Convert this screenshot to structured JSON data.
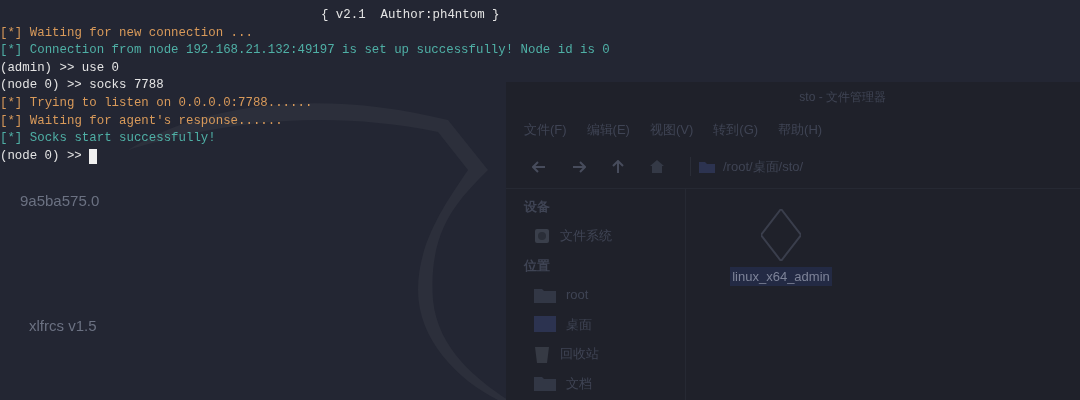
{
  "desktop": {
    "icons": [
      {
        "label": "9a5ba575.0"
      },
      {
        "label": "xlfrcs v1.5"
      }
    ]
  },
  "file_manager": {
    "title": "sto - 文件管理器",
    "menu": [
      "文件(F)",
      "编辑(E)",
      "视图(V)",
      "转到(G)",
      "帮助(H)"
    ],
    "path": "/root/桌面/sto/",
    "sidebar": [
      {
        "heading": "设备",
        "items": [
          {
            "label": "文件系统",
            "kind": "drive"
          }
        ]
      },
      {
        "heading": "位置",
        "items": [
          {
            "label": "root",
            "kind": "folder"
          },
          {
            "label": "桌面",
            "kind": "desktop"
          },
          {
            "label": "回收站",
            "kind": "trash"
          },
          {
            "label": "文档",
            "kind": "folder"
          }
        ]
      }
    ],
    "files": [
      {
        "name": "linux_x64_admin",
        "selected": true
      }
    ]
  },
  "terminal": {
    "banner": "{ v2.1  Author:ph4ntom }",
    "lines": [
      {
        "kind": "info",
        "tag": "[*]",
        "text": "Waiting for new connection ..."
      },
      {
        "kind": "success",
        "tag": "[*]",
        "text": "Connection from node 192.168.21.132:49197 is set up successfully! Node id is 0"
      },
      {
        "kind": "prompt",
        "prompt": "(admin) >>",
        "text": "use 0"
      },
      {
        "kind": "prompt",
        "prompt": "(node 0) >>",
        "text": "socks 7788"
      },
      {
        "kind": "info",
        "tag": "[*]",
        "text": "Trying to listen on 0.0.0.0:7788......"
      },
      {
        "kind": "info",
        "tag": "[*]",
        "text": "Waiting for agent's response......"
      },
      {
        "kind": "success",
        "tag": "[*]",
        "text": "Socks start successfully!"
      },
      {
        "kind": "prompt",
        "prompt": "(node 0) >>",
        "cursor": true
      }
    ]
  }
}
